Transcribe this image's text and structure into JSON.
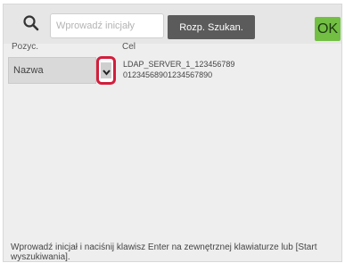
{
  "header": {
    "search_placeholder": "Wprowadź inicjały",
    "search_value": "",
    "search_button_label": "Rozp. Szukan.",
    "ok_button_label": "OK",
    "icons": {
      "search": "search-icon"
    },
    "colors": {
      "ok_button": "#72bf44",
      "search_button": "#5b5b5b",
      "highlight_border": "#d21e3c"
    }
  },
  "table": {
    "columns": [
      "Pozyc.",
      "Cel"
    ],
    "selected_field": "Nazwa",
    "target_lines": [
      "LDAP_SERVER_1_123456789",
      "01234568901234567890"
    ],
    "dropdown_icon": "chevron-down-icon"
  },
  "footer": {
    "hint_line_1": "Wprowadź inicjał i naciśnij klawisz Enter na zewnętrznej klawiaturze lub [Start",
    "hint_line_2": "wyszukiwania]."
  }
}
